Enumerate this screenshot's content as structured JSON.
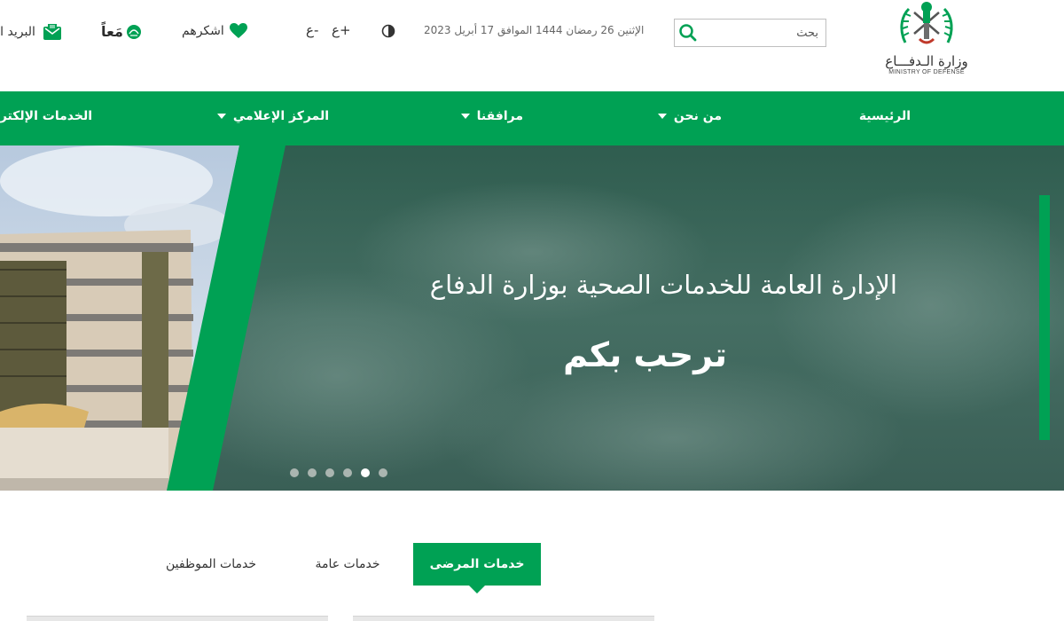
{
  "header": {
    "logo": {
      "arabic": "وزارة الـدفـــاع",
      "english": "MINISTRY OF DEFENSE"
    },
    "search": {
      "placeholder": "بحث"
    },
    "date": "الإثنين 26 رمضان 1444 الموافق 17 أبريل 2023",
    "font_increase": "ع+",
    "font_decrease": "ع-",
    "thanks_label": "اشكرهم",
    "together_label": "مَعاً",
    "mail_label": "البريد ال"
  },
  "nav": {
    "items": [
      {
        "label": "الرئيسية",
        "has_dropdown": false
      },
      {
        "label": "من نحن",
        "has_dropdown": true
      },
      {
        "label": "مرافقنا",
        "has_dropdown": true
      },
      {
        "label": "المركز الإعلامي",
        "has_dropdown": true
      },
      {
        "label": "الخدمات الإلكترونية",
        "has_dropdown": false
      }
    ]
  },
  "hero": {
    "title": "الإدارة العامة للخدمات الصحية بوزارة الدفاع",
    "subtitle": "ترحب بكم",
    "slides_count": 6,
    "active_slide": 5
  },
  "tabs": {
    "items": [
      {
        "label": "خدمات المرضى",
        "active": true
      },
      {
        "label": "خدمات عامة",
        "active": false
      },
      {
        "label": "خدمات الموظفين",
        "active": false
      }
    ]
  },
  "colors": {
    "brand_green": "#00a154",
    "hero_overlay": "#3c6558"
  }
}
